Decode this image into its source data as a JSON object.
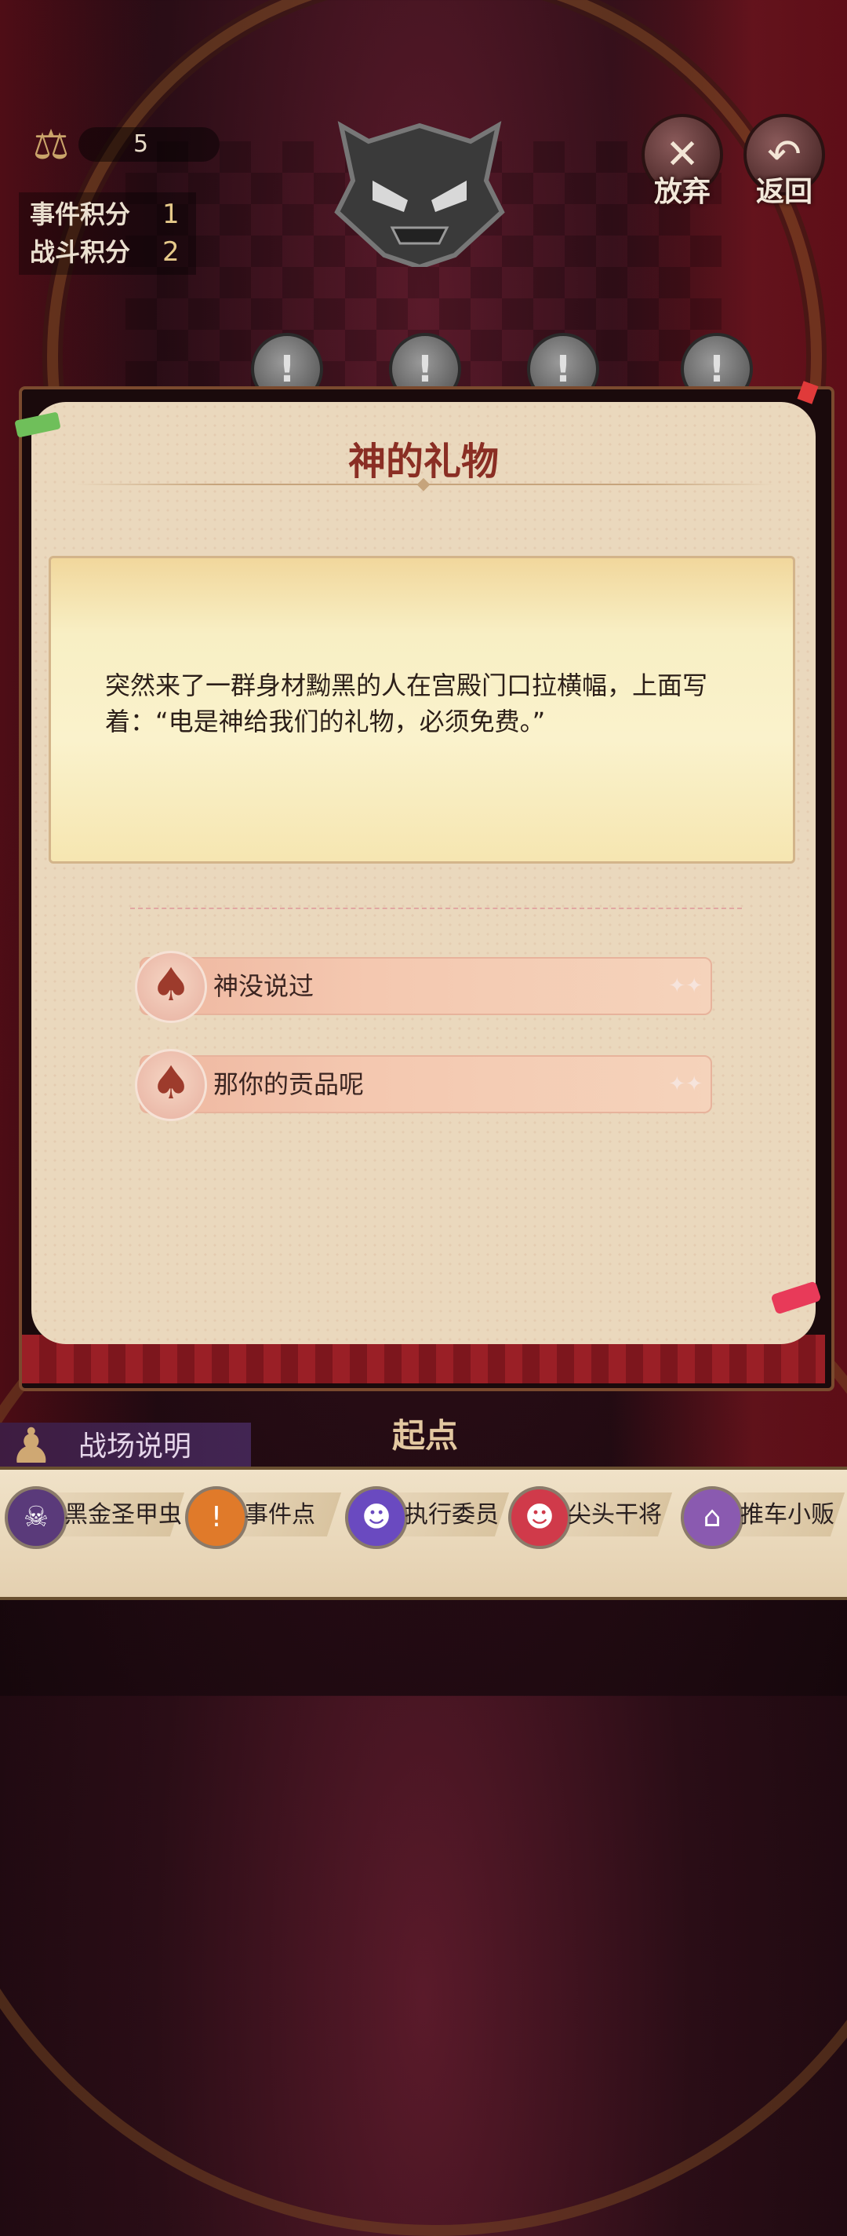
{
  "hud": {
    "scale_icon": "scale-icon",
    "count": "5",
    "event_score_label": "事件积分",
    "event_score_value": "1",
    "battle_score_label": "战斗积分",
    "battle_score_value": "2"
  },
  "top_buttons": {
    "abandon_label": "放弃",
    "back_label": "返回"
  },
  "map": {
    "node_symbol": "!",
    "start_label": "起点"
  },
  "dialog": {
    "title": "神的礼物",
    "event_text": "突然来了一群身材黝黑的人在宫殿门口拉横幅，上面写着：“电是神给我们的礼物，必须免费。”",
    "choices": [
      {
        "label": "神没说过",
        "icon": "spade-icon"
      },
      {
        "label": "那你的贡品呢",
        "icon": "spade-icon"
      }
    ]
  },
  "legend": {
    "title": "战场说明",
    "items": [
      {
        "label": "黑金圣甲虫",
        "icon": "beetle-boss-icon",
        "color": "#5a3a7a"
      },
      {
        "label": "事件点",
        "icon": "exclamation-icon",
        "color": "#e07a2a"
      },
      {
        "label": "执行委员",
        "icon": "purple-demon-icon",
        "color": "#6a4ac0"
      },
      {
        "label": "尖头干将",
        "icon": "red-demon-icon",
        "color": "#d03a4a"
      },
      {
        "label": "推车小贩",
        "icon": "shop-icon",
        "color": "#8a5ab0"
      }
    ]
  },
  "colors": {
    "title": "#8a2e24",
    "dialog_bg": "#ead8bd",
    "choice_bg": "#f4c8b0"
  }
}
